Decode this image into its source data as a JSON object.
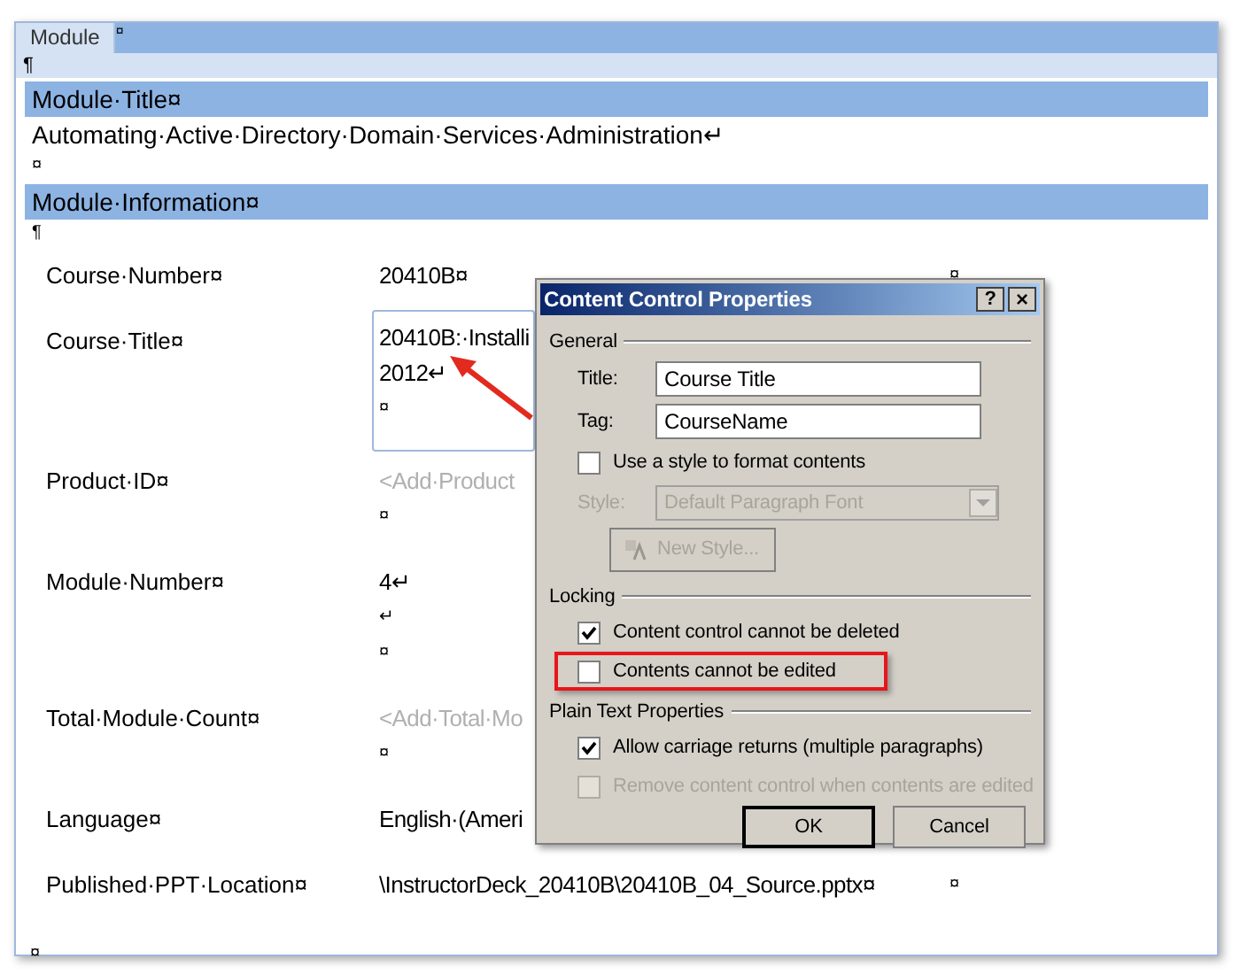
{
  "document": {
    "tab_label": "Module",
    "tab_mark": "¤",
    "pilcrow": "¶",
    "sections": [
      {
        "heading": "Module·Title¤",
        "lines": [
          "Automating·Active·Directory·Domain·Services·Administration↵",
          "¤"
        ]
      },
      {
        "heading": "Module·Information¤",
        "lines": [
          "¶"
        ]
      }
    ],
    "rows": [
      {
        "label": "Course·Number¤",
        "kind": "text",
        "lines": [
          "20410B¤"
        ],
        "end_mark": "¤"
      },
      {
        "label": "Course·Title¤",
        "kind": "box",
        "lines": [
          "20410B:·Installi",
          "2012↵",
          "¤"
        ]
      },
      {
        "label": "Product·ID¤",
        "kind": "placeholder",
        "lines": [
          "<Add·Product",
          "¤"
        ]
      },
      {
        "label": "Module·Number¤",
        "kind": "text",
        "lines": [
          "4↵",
          "↵",
          "¤"
        ]
      },
      {
        "label": "Total·Module·Count¤",
        "kind": "placeholder",
        "lines": [
          "<Add·Total·Mo",
          "¤"
        ]
      },
      {
        "label": "Language¤",
        "kind": "text",
        "lines": [
          "English·(Ameri"
        ]
      },
      {
        "label": "Published·PPT·Location¤",
        "kind": "text",
        "lines": [
          "\\InstructorDeck_20410B\\20410B_04_Source.pptx¤"
        ],
        "end_mark": "¤"
      }
    ],
    "end_mark": "¤"
  },
  "dialog": {
    "title": "Content Control Properties",
    "help": "?",
    "close": "×",
    "groups": [
      {
        "heading": "General",
        "items": [
          {
            "kind": "field",
            "label": "Title:",
            "value": "Course Title"
          },
          {
            "kind": "field",
            "label": "Tag:",
            "value": "CourseName"
          },
          {
            "kind": "checkbox",
            "label": "Use a style to format contents",
            "checked": false,
            "disabled": false,
            "highlighted": false
          },
          {
            "kind": "select",
            "label": "Style:",
            "value": "Default Paragraph Font",
            "disabled": true
          },
          {
            "kind": "button",
            "label": "New Style...",
            "disabled": true
          }
        ]
      },
      {
        "heading": "Locking",
        "items": [
          {
            "kind": "checkbox",
            "label": "Content control cannot be deleted",
            "checked": true,
            "disabled": false,
            "highlighted": false
          },
          {
            "kind": "checkbox",
            "label": "Contents cannot be edited",
            "checked": false,
            "disabled": false,
            "highlighted": true
          }
        ]
      },
      {
        "heading": "Plain Text Properties",
        "items": [
          {
            "kind": "checkbox",
            "label": "Allow carriage returns (multiple paragraphs)",
            "checked": true,
            "disabled": false,
            "highlighted": false
          },
          {
            "kind": "checkbox",
            "label": "Remove content control when contents are edited",
            "checked": false,
            "disabled": true,
            "highlighted": false
          }
        ]
      }
    ],
    "buttons": [
      "OK",
      "Cancel"
    ]
  }
}
